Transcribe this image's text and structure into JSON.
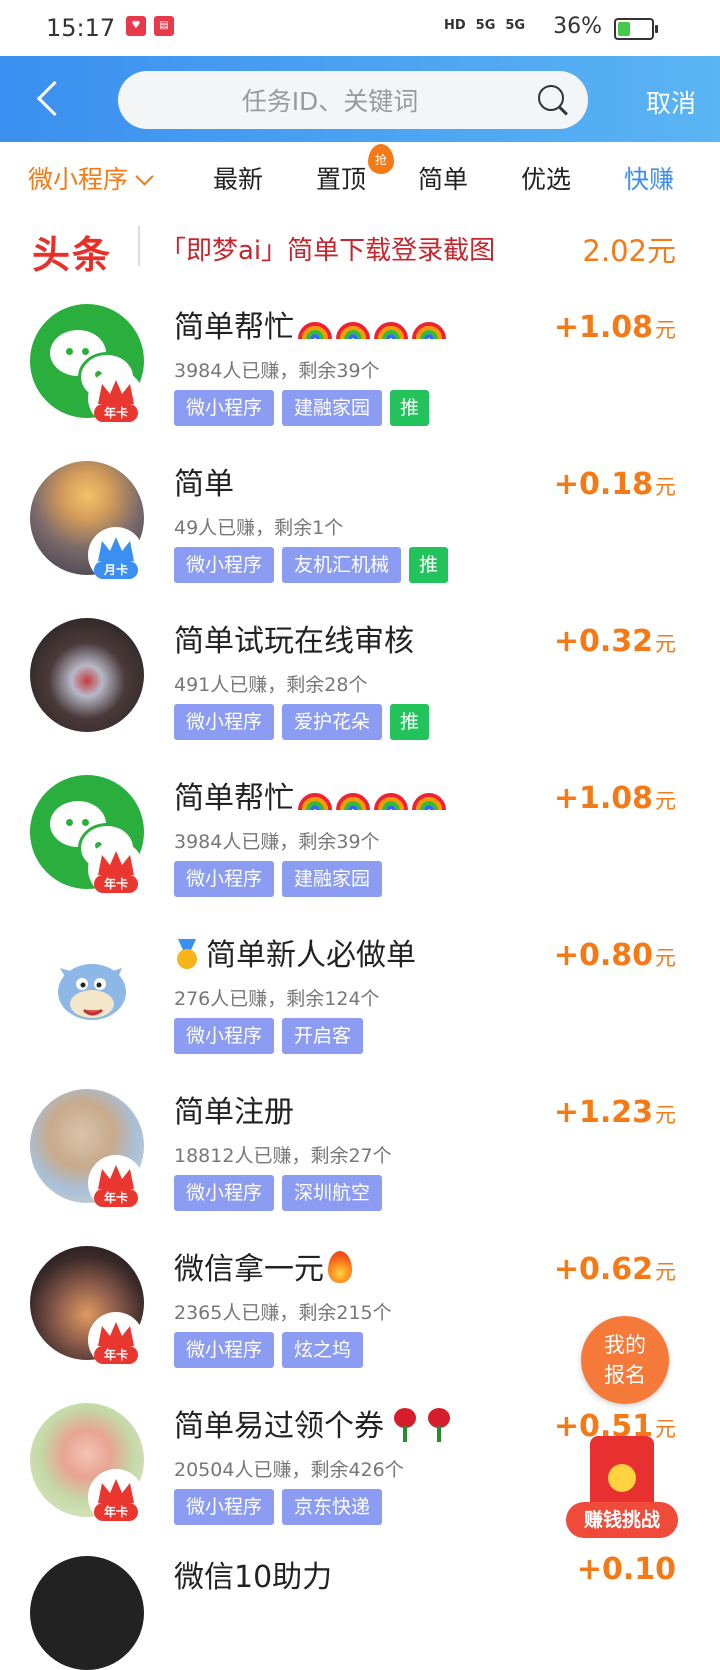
{
  "status_bar": {
    "time": "15:17",
    "net1": "HD",
    "net2": "5G",
    "net3": "5G",
    "battery": "36%",
    "battery_level": 0.36
  },
  "header": {
    "back_icon": "back-arrow-icon",
    "search_placeholder": "任务ID、关键词",
    "search_icon": "search-icon",
    "cancel_label": "取消"
  },
  "tabs": [
    {
      "label": "微小程序"
    },
    {
      "label": "最新"
    },
    {
      "label": "置顶"
    },
    {
      "label": "简单"
    },
    {
      "label": "优选"
    },
    {
      "label": "快赚"
    }
  ],
  "hot_badge": "抢",
  "headline": {
    "tag": "头条",
    "text": "「即梦ai」简单下载登录截图",
    "price": "2.02元"
  },
  "tasks": [
    {
      "title": "简单帮忙",
      "meta": "3984人已赚，剩余39个",
      "tags": [
        "微小程序",
        "建融家园"
      ],
      "push": "推",
      "price": "+1.08",
      "unit": "元",
      "crown": "年卡"
    },
    {
      "title": "简单",
      "meta": "49人已赚，剩余1个",
      "tags": [
        "微小程序",
        "友机汇机械"
      ],
      "push": "推",
      "price": "+0.18",
      "unit": "元",
      "crown": "月卡"
    },
    {
      "title": "简单试玩在线审核",
      "meta": "491人已赚，剩余28个",
      "tags": [
        "微小程序",
        "爱护花朵"
      ],
      "push": "推",
      "price": "+0.32",
      "unit": "元"
    },
    {
      "title": "简单帮忙",
      "meta": "3984人已赚，剩余39个",
      "tags": [
        "微小程序",
        "建融家园"
      ],
      "price": "+1.08",
      "unit": "元",
      "crown": "年卡"
    },
    {
      "title": "简单新人必做单",
      "meta": "276人已赚，剩余124个",
      "tags": [
        "微小程序",
        "开启客"
      ],
      "price": "+0.80",
      "unit": "元"
    },
    {
      "title": "简单注册",
      "meta": "18812人已赚，剩余27个",
      "tags": [
        "微小程序",
        "深圳航空"
      ],
      "price": "+1.23",
      "unit": "元",
      "crown": "年卡"
    },
    {
      "title": "微信拿一元",
      "meta": "2365人已赚，剩余215个",
      "tags": [
        "微小程序",
        "炫之坞"
      ],
      "price": "+0.62",
      "unit": "元",
      "crown": "年卡"
    },
    {
      "title": "简单易过领个券",
      "meta": "20504人已赚，剩余426个",
      "tags": [
        "微小程序",
        "京东快递"
      ],
      "price": "+0.51",
      "unit": "元",
      "crown": "年卡"
    }
  ],
  "fab_signup": {
    "line1": "我的",
    "line2": "报名"
  },
  "fab_challenge": "赚钱挑战",
  "peek_title": "微信10助力",
  "peek_price": "+0.10"
}
